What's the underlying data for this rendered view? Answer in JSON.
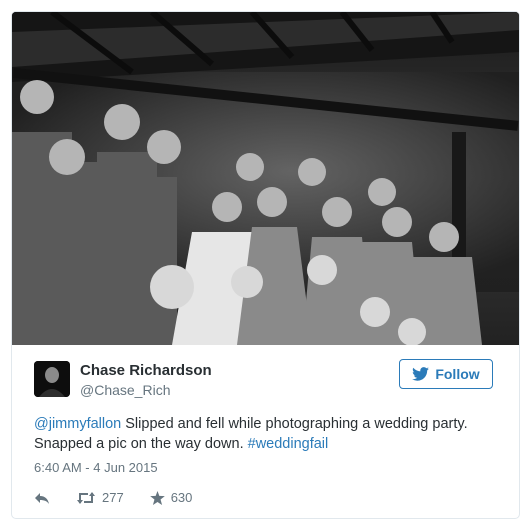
{
  "author": {
    "name": "Chase Richardson",
    "handle": "@Chase_Rich"
  },
  "follow_button": {
    "label": "Follow",
    "icon": "twitter-bird-icon"
  },
  "tweet": {
    "mention": "@jimmyfallon",
    "text": " Slipped and fell while photographing a wedding party. Snapped a pic on the way down. ",
    "hashtag": "#weddingfail",
    "timestamp": "6:40 AM - 4 Jun 2015"
  },
  "actions": {
    "reply_icon": "reply-icon",
    "retweet_icon": "retweet-icon",
    "retweet_count": "277",
    "favorite_icon": "star-icon",
    "favorite_count": "630"
  },
  "colors": {
    "link": "#2b7bb9",
    "text": "#292f33",
    "muted": "#66757f",
    "border": "#e1e8ed"
  }
}
